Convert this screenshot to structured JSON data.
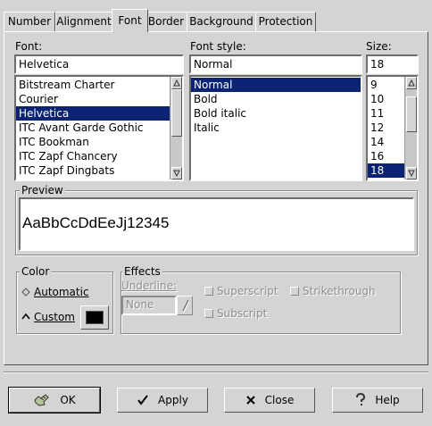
{
  "tabs": [
    {
      "label": "Number",
      "active": false
    },
    {
      "label": "Alignment",
      "active": false
    },
    {
      "label": "Font",
      "active": true
    },
    {
      "label": "Border",
      "active": false
    },
    {
      "label": "Background",
      "active": false
    },
    {
      "label": "Protection",
      "active": false
    }
  ],
  "font": {
    "label": "Font:",
    "value": "Helvetica",
    "items": [
      "Bitstream Charter",
      "Courier",
      "Helvetica",
      "ITC Avant Garde Gothic",
      "ITC Bookman",
      "ITC Zapf Chancery",
      "ITC Zapf Dingbats"
    ],
    "selected": "Helvetica"
  },
  "style": {
    "label": "Font style:",
    "value": "Normal",
    "items": [
      "Normal",
      "Bold",
      "Bold italic",
      "Italic"
    ],
    "selected": "Normal"
  },
  "size": {
    "label": "Size:",
    "value": "18",
    "items": [
      "9",
      "10",
      "11",
      "12",
      "14",
      "16",
      "18"
    ],
    "selected": "18"
  },
  "preview": {
    "title": "Preview",
    "text": "AaBbCcDdEeJj12345"
  },
  "color": {
    "title": "Color",
    "automatic": "Automatic",
    "custom": "Custom",
    "swatch": "#000000"
  },
  "effects": {
    "title": "Effects",
    "underline_label": "Underline:",
    "underline_value": "None",
    "superscript": "Superscript",
    "subscript": "Subscript",
    "strikethrough": "Strikethrough"
  },
  "buttons": {
    "ok": "OK",
    "apply": "Apply",
    "close": "Close",
    "help": "Help"
  },
  "colors": {
    "selection": "#0a2373",
    "background": "#d4d4d4"
  }
}
